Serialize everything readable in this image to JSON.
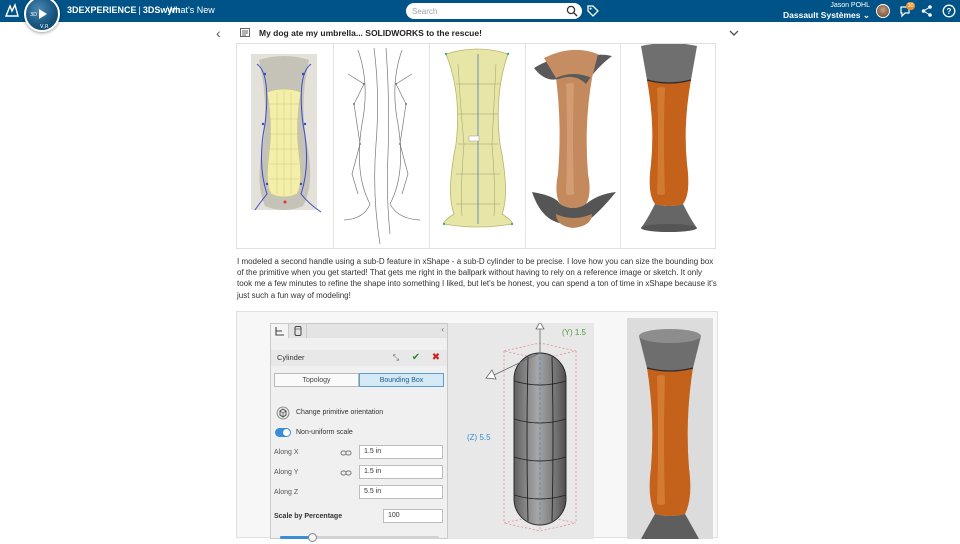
{
  "header": {
    "brand_bold": "3DEXPERIENCE",
    "brand_sep": "|",
    "brand_app": "3DSwym",
    "whats_new": "What's New",
    "search_placeholder": "Search",
    "user_name": "Jason POHL",
    "org": "Dassault Systèmes",
    "notification_count": "30",
    "compass_label": "V,R"
  },
  "post": {
    "title": "My dog ate my umbrella... SOLIDWORKS to the rescue!",
    "body": "I modeled a second handle using a sub-D feature in xShape - a sub-D cylinder to be precise. I love how you can size the bounding box of the primitive when you get started! That gets me right in the ballpark without having to rely on a reference image or sketch. It only took me a few minutes to refine the shape into something I liked, but let's be honest, you can spend a ton of time in xShape because it's just such a fun way of modeling!"
  },
  "panel": {
    "title": "Cylinder",
    "segments": [
      "Topology",
      "Bounding Box"
    ],
    "active_segment": "Bounding Box",
    "change_orientation": "Change primitive orientation",
    "non_uniform_scale": "Non-uniform scale",
    "non_uniform_scale_on": true,
    "fields": [
      {
        "label": "Along X",
        "value": "1.5 in"
      },
      {
        "label": "Along Y",
        "value": "1.5 in"
      },
      {
        "label": "Along Z",
        "value": "5.5 in"
      }
    ],
    "scale_label": "Scale by Percentage",
    "scale_value": "100",
    "slider_fraction": 0.2
  },
  "viewport": {
    "y_label": "(Y) 1.5",
    "z_label": "(Z) 5.5"
  },
  "colors": {
    "topbar": "#005386",
    "accent": "#3a8dd6",
    "handle_orange": "#c4611b",
    "handle_gray": "#6a6a6a",
    "mesh_yellow": "#e8e6a6"
  }
}
